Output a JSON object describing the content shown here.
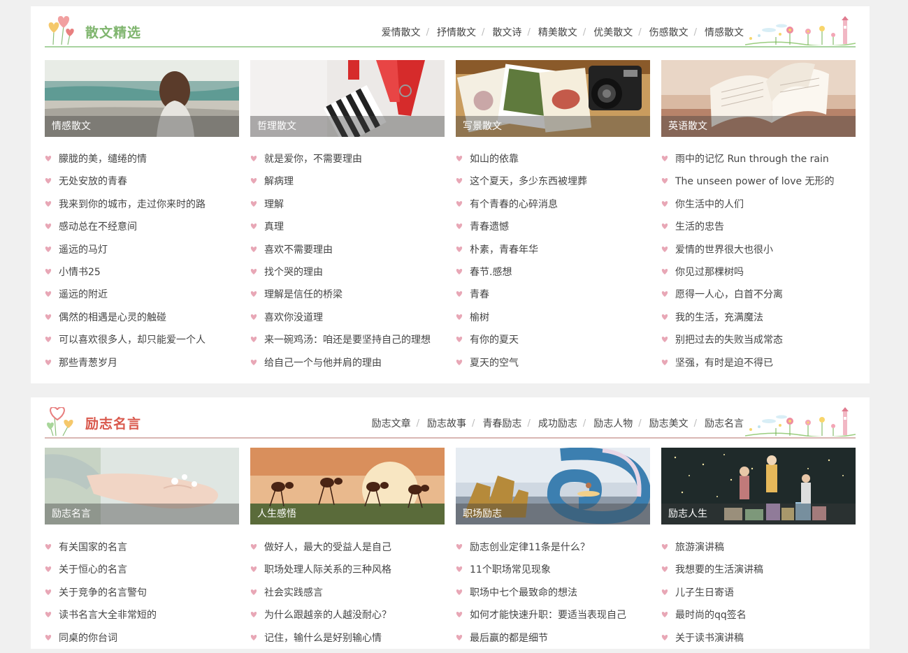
{
  "sections": [
    {
      "title": "散文精选",
      "nav": [
        "爱情散文",
        "抒情散文",
        "散文诗",
        "精美散文",
        "优美散文",
        "伤感散文",
        "情感散文"
      ],
      "cards": [
        {
          "caption": "情感散文",
          "items": [
            "朦胧的美，缱绻的情",
            "无处安放的青春",
            "我来到你的城市，走过你来时的路",
            "感动总在不经意间",
            "遥远的马灯",
            "小情书25",
            "遥远的附近",
            "偶然的相遇是心灵的触碰",
            "可以喜欢很多人，却只能爱一个人",
            "那些青葱岁月"
          ]
        },
        {
          "caption": "哲理散文",
          "items": [
            "就是爱你，不需要理由",
            "解病理",
            "理解",
            "真理",
            "喜欢不需要理由",
            "找个哭的理由",
            "理解是信任的桥梁",
            "喜欢你没道理",
            "来一碗鸡汤：咱还是要坚持自己的理想",
            "给自己一个与他并肩的理由"
          ]
        },
        {
          "caption": "写景散文",
          "items": [
            "如山的依靠",
            "这个夏天，多少东西被埋葬",
            "有个青春的心碎消息",
            "青春遗憾",
            "朴素，青春年华",
            "春节.感想",
            "青春",
            "榆树",
            "有你的夏天",
            "夏天的空气"
          ]
        },
        {
          "caption": "英语散文",
          "items": [
            "雨中的记忆 Run through the rain",
            "The unseen power of love 无形的",
            "你生活中的人们",
            "生活的忠告",
            "爱情的世界很大也很小",
            "你见过那棵树吗",
            "愿得一人心，白首不分离",
            "我的生活，充满魔法",
            "别把过去的失败当成常态",
            "坚强，有时是迫不得已"
          ]
        }
      ]
    },
    {
      "title": "励志名言",
      "nav": [
        "励志文章",
        "励志故事",
        "青春励志",
        "成功励志",
        "励志人物",
        "励志美文",
        "励志名言"
      ],
      "cards": [
        {
          "caption": "励志名言",
          "items": [
            "有关国家的名言",
            "关于恒心的名言",
            "关于竞争的名言警句",
            "读书名言大全非常短的",
            "同桌的你台词"
          ]
        },
        {
          "caption": "人生感悟",
          "items": [
            "做好人，最大的受益人是自己",
            "职场处理人际关系的三种风格",
            "社会实践感言",
            "为什么跟越亲的人越没耐心？",
            "记住，输什么是好别输心情"
          ]
        },
        {
          "caption": "职场励志",
          "items": [
            "励志创业定律11条是什么？",
            "11个职场常见现象",
            "职场中七个最致命的想法",
            "如何才能快速升职：要适当表现自己",
            "最后赢的都是细节"
          ]
        },
        {
          "caption": "励志人生",
          "items": [
            "旅游演讲稿",
            "我想要的生活演讲稿",
            "儿子生日寄语",
            "最时尚的qq签名",
            "关于读书演讲稿"
          ]
        }
      ]
    }
  ],
  "colors": {
    "green_title": "#7fb56e",
    "red_title": "#d9584c",
    "bullet": "#e8a7b6",
    "page_bg": "#f0f0f0"
  },
  "icons": {
    "bullet": "heart-bullet-icon",
    "logo": "hearts-logo-icon",
    "decor": "flowers-decoration-icon"
  }
}
